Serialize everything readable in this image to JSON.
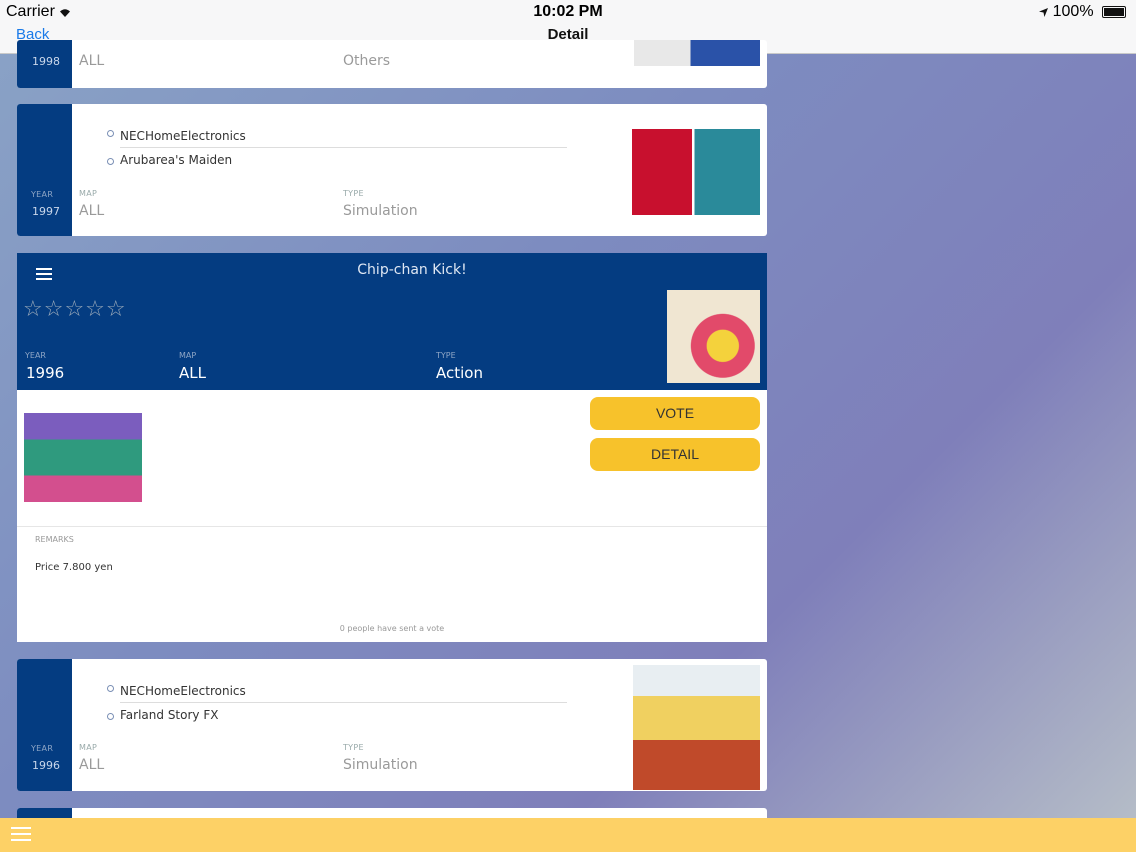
{
  "status_bar": {
    "carrier": "Carrier",
    "time": "10:02 PM",
    "battery": "100%"
  },
  "nav": {
    "back_label": "Back",
    "title": "Detail"
  },
  "labels": {
    "year": "YEAR",
    "map": "MAP",
    "type": "TYPE",
    "remarks": "REMARKS"
  },
  "cards": [
    {
      "year": "1998",
      "map": "ALL",
      "type": "Others"
    },
    {
      "maker": "NECHomeElectronics",
      "name": "Arubarea's Maiden",
      "year": "1997",
      "map": "ALL",
      "type": "Simulation"
    },
    {
      "maker": "NECHomeElectronics",
      "name": "Farland Story FX",
      "year": "1996",
      "map": "ALL",
      "type": "Simulation"
    }
  ],
  "expanded": {
    "title": "Chip-chan Kick!",
    "stars": "☆☆☆☆☆",
    "rating": 0,
    "year": "1996",
    "map": "ALL",
    "type": "Action",
    "vote_label": "VOTE",
    "detail_label": "DETAIL",
    "remarks_text": "Price 7.800 yen",
    "vote_count_text": "0 people have sent a vote"
  },
  "colors": {
    "accent": "#043c81",
    "button": "#f7c22b",
    "bottom_bar": "#fdd166",
    "link": "#1a7ae8"
  },
  "icons": {
    "menu": "hamburger-menu-icon",
    "wifi": "wifi-icon",
    "location": "location-arrow-icon",
    "battery": "battery-icon"
  }
}
